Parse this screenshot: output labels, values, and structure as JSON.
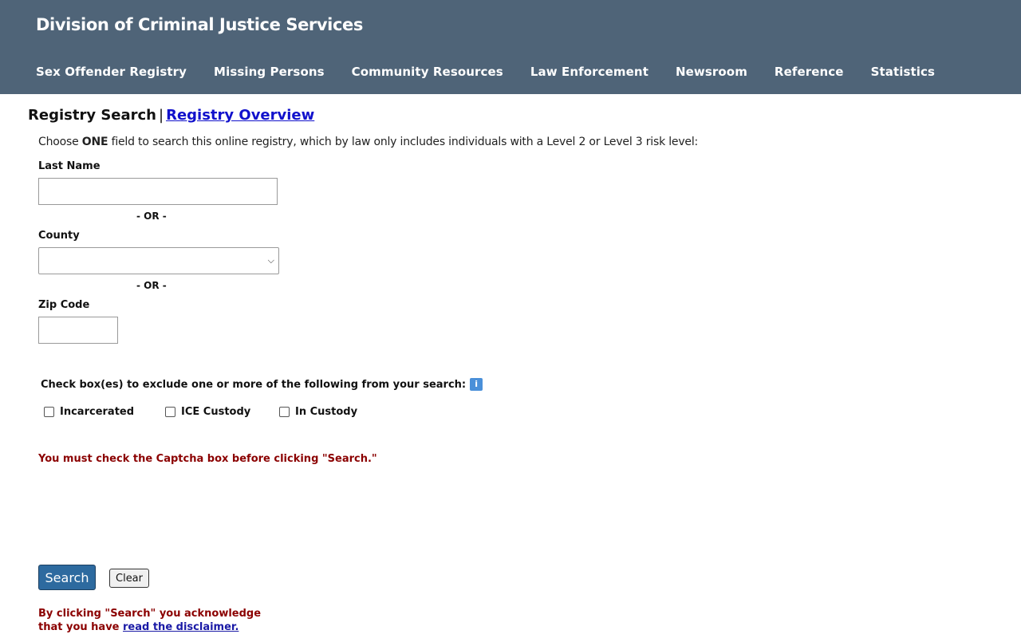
{
  "header": {
    "site_title": "Division of Criminal Justice Services",
    "nav": [
      {
        "label": "Sex Offender Registry"
      },
      {
        "label": "Missing Persons"
      },
      {
        "label": "Community Resources"
      },
      {
        "label": "Law Enforcement"
      },
      {
        "label": "Newsroom"
      },
      {
        "label": "Reference"
      },
      {
        "label": "Statistics"
      }
    ]
  },
  "main": {
    "heading": "Registry Search",
    "heading_separator": "|",
    "heading_link": "Registry Overview",
    "instructions_before": "Choose ",
    "instructions_emphasis": "ONE",
    "instructions_after": " field to search this online registry, which by law only includes individuals with a Level 2 or Level 3 risk level:",
    "last_name_label": "Last Name",
    "last_name_value": "",
    "or_text_1": "- OR -",
    "county_label": "County",
    "county_selected": "",
    "or_text_2": "- OR -",
    "zip_label": "Zip Code",
    "zip_value": "",
    "exclude_label": "Check box(es) to exclude one or more of the following from your search:",
    "info_icon": "info-icon",
    "exclusions": [
      {
        "label": "Incarcerated",
        "checked": false
      },
      {
        "label": "ICE Custody",
        "checked": false
      },
      {
        "label": "In Custody",
        "checked": false
      }
    ],
    "captcha_warning": "You must check the Captcha box before clicking \"Search.\"",
    "search_label": "Search",
    "clear_label": "Clear",
    "ack_line1": "By clicking \"Search\" you acknowledge",
    "ack_line2_prefix": "that you have ",
    "ack_link": "read the disclaimer."
  },
  "colors": {
    "header_bg": "#4f6478",
    "warning_text": "#8b0000",
    "link": "#1111cc",
    "search_button_bg": "#2d6a9f",
    "info_icon_bg": "#4a90d9"
  }
}
